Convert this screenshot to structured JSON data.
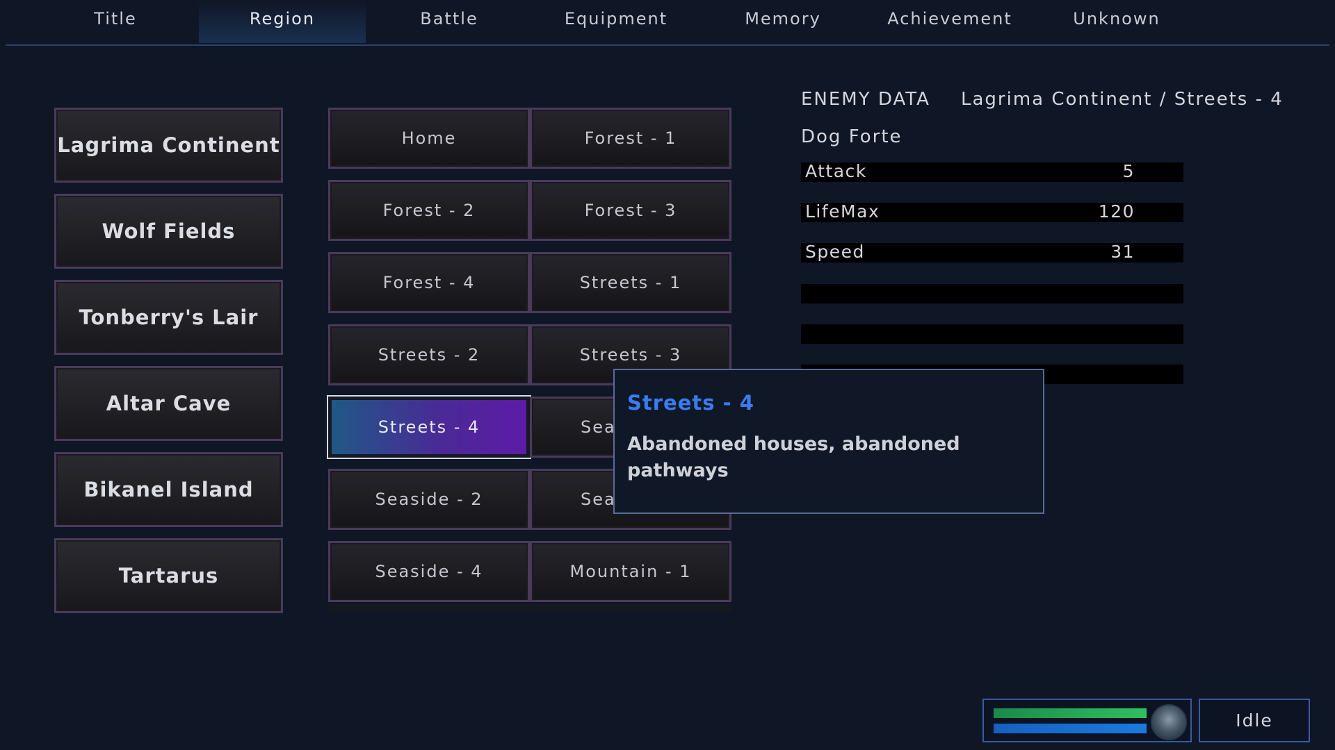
{
  "tabs": [
    "Title",
    "Region",
    "Battle",
    "Equipment",
    "Memory",
    "Achievement",
    "Unknown"
  ],
  "active_tab": "Region",
  "regions": [
    "Lagrima Continent",
    "Wolf Fields",
    "Tonberry's Lair",
    "Altar Cave",
    "Bikanel Island",
    "Tartarus"
  ],
  "areas": {
    "home": "Home",
    "forest_1": "Forest - 1",
    "forest_2": "Forest - 2",
    "forest_3": "Forest - 3",
    "forest_4": "Forest - 4",
    "streets_1": "Streets - 1",
    "streets_2": "Streets - 2",
    "streets_3": "Streets - 3",
    "streets_4": "Streets - 4",
    "seaside_1": "Sea",
    "seaside_2": "Seaside - 2",
    "seaside_3": "Sea",
    "seaside_4": "Seaside - 4",
    "mountain_1": "Mountain - 1"
  },
  "selected_area": "Streets - 4",
  "enemy_data": {
    "heading": "ENEMY DATA",
    "location": "Lagrima Continent /  Streets - 4",
    "enemy_name": "Dog Forte",
    "stats": [
      {
        "label": "Attack",
        "value": "5"
      },
      {
        "label": "LifeMax",
        "value": "120"
      },
      {
        "label": "Speed",
        "value": "31"
      }
    ]
  },
  "tooltip": {
    "title": "Streets - 4",
    "description": "Abandoned houses, abandoned pathways"
  },
  "status": {
    "idle_label": "Idle",
    "hp_fraction": 1.0,
    "energy_fraction": 1.0,
    "hp_color": "#2fc060",
    "energy_color": "#1a7ae0"
  },
  "colors": {
    "background": "#0f1626",
    "accent_blue": "#3a7cf0",
    "button_border": "#4a3a5a"
  }
}
